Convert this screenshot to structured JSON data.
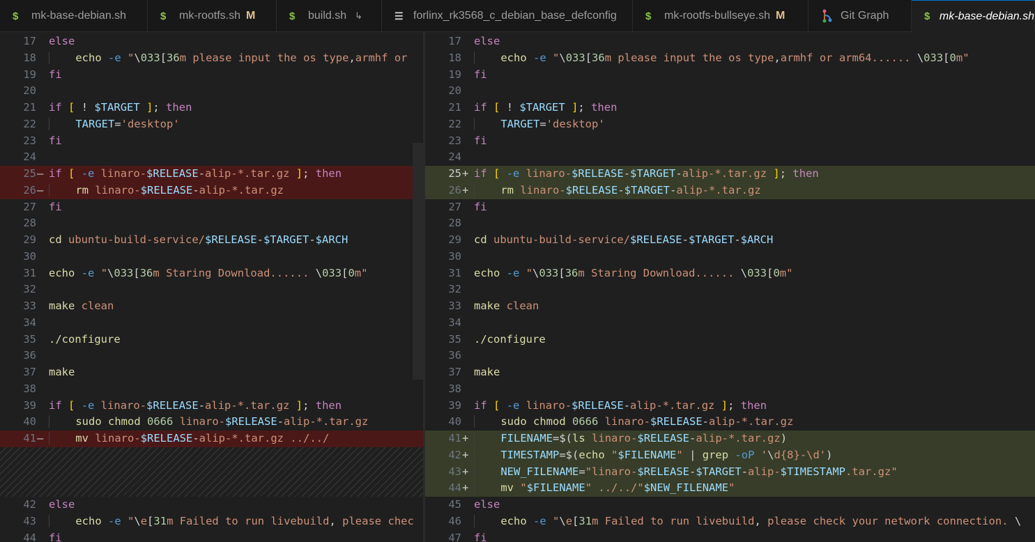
{
  "tabs": [
    {
      "label": "mk-base-debian.sh",
      "icon": "dollar-icon",
      "badge": "",
      "link": false,
      "active": false
    },
    {
      "label": "mk-rootfs.sh",
      "icon": "dollar-icon",
      "badge": "M",
      "link": false,
      "active": false
    },
    {
      "label": "build.sh",
      "icon": "dollar-icon",
      "badge": "",
      "link": true,
      "active": false
    },
    {
      "label": "forlinx_rk3568_c_debian_base_defconfig",
      "icon": "lines-icon",
      "badge": "",
      "link": false,
      "active": false
    },
    {
      "label": "mk-rootfs-bullseye.sh",
      "icon": "dollar-icon",
      "badge": "M",
      "link": false,
      "active": false
    },
    {
      "label": "Git Graph",
      "icon": "git-graph-icon",
      "badge": "",
      "link": false,
      "active": false
    },
    {
      "label": "mk-base-debian.sh",
      "icon": "dollar-icon",
      "badge": "",
      "link": false,
      "active": true
    }
  ],
  "left": [
    {
      "n": "17",
      "code": "else"
    },
    {
      "n": "18",
      "code": "    echo -e \"\\033[36m please input the os type,armhf or"
    },
    {
      "n": "19",
      "code": "fi"
    },
    {
      "n": "20",
      "code": ""
    },
    {
      "n": "21",
      "code": "if [ ! $TARGET ]; then"
    },
    {
      "n": "22",
      "code": "    TARGET='desktop'"
    },
    {
      "n": "23",
      "code": "fi"
    },
    {
      "n": "24",
      "code": ""
    },
    {
      "n": "25",
      "code": "if [ -e linaro-$RELEASE-alip-*.tar.gz ]; then",
      "mark": "—",
      "kind": "del"
    },
    {
      "n": "26",
      "code": "    rm linaro-$RELEASE-alip-*.tar.gz",
      "mark": "—",
      "kind": "del"
    },
    {
      "n": "27",
      "code": "fi"
    },
    {
      "n": "28",
      "code": ""
    },
    {
      "n": "29",
      "code": "cd ubuntu-build-service/$RELEASE-$TARGET-$ARCH"
    },
    {
      "n": "30",
      "code": ""
    },
    {
      "n": "31",
      "code": "echo -e \"\\033[36m Staring Download...... \\033[0m\""
    },
    {
      "n": "32",
      "code": ""
    },
    {
      "n": "33",
      "code": "make clean"
    },
    {
      "n": "34",
      "code": ""
    },
    {
      "n": "35",
      "code": "./configure"
    },
    {
      "n": "36",
      "code": ""
    },
    {
      "n": "37",
      "code": "make"
    },
    {
      "n": "38",
      "code": ""
    },
    {
      "n": "39",
      "code": "if [ -e linaro-$RELEASE-alip-*.tar.gz ]; then"
    },
    {
      "n": "40",
      "code": "    sudo chmod 0666 linaro-$RELEASE-alip-*.tar.gz"
    },
    {
      "n": "41",
      "code": "    mv linaro-$RELEASE-alip-*.tar.gz ../../",
      "mark": "—",
      "kind": "del"
    },
    {
      "filler": true
    },
    {
      "n": "42",
      "code": "else"
    },
    {
      "n": "43",
      "code": "    echo -e \"\\e[31m Failed to run livebuild, please chec"
    },
    {
      "n": "44",
      "code": "fi"
    }
  ],
  "right": [
    {
      "n": "17",
      "code": "else"
    },
    {
      "n": "18",
      "code": "    echo -e \"\\033[36m please input the os type,armhf or arm64...... \\033[0m\""
    },
    {
      "n": "19",
      "code": "fi"
    },
    {
      "n": "20",
      "code": ""
    },
    {
      "n": "21",
      "code": "if [ ! $TARGET ]; then"
    },
    {
      "n": "22",
      "code": "    TARGET='desktop'"
    },
    {
      "n": "23",
      "code": "fi"
    },
    {
      "n": "24",
      "code": ""
    },
    {
      "n": "25",
      "code": "if [ -e linaro-$RELEASE-$TARGET-alip-*.tar.gz ]; then",
      "mark": "+",
      "kind": "ins",
      "cur": true
    },
    {
      "n": "26",
      "code": "    rm linaro-$RELEASE-$TARGET-alip-*.tar.gz",
      "mark": "+",
      "kind": "ins"
    },
    {
      "n": "27",
      "code": "fi"
    },
    {
      "n": "28",
      "code": ""
    },
    {
      "n": "29",
      "code": "cd ubuntu-build-service/$RELEASE-$TARGET-$ARCH"
    },
    {
      "n": "30",
      "code": ""
    },
    {
      "n": "31",
      "code": "echo -e \"\\033[36m Staring Download...... \\033[0m\""
    },
    {
      "n": "32",
      "code": ""
    },
    {
      "n": "33",
      "code": "make clean"
    },
    {
      "n": "34",
      "code": ""
    },
    {
      "n": "35",
      "code": "./configure"
    },
    {
      "n": "36",
      "code": ""
    },
    {
      "n": "37",
      "code": "make"
    },
    {
      "n": "38",
      "code": ""
    },
    {
      "n": "39",
      "code": "if [ -e linaro-$RELEASE-alip-*.tar.gz ]; then"
    },
    {
      "n": "40",
      "code": "    sudo chmod 0666 linaro-$RELEASE-alip-*.tar.gz"
    },
    {
      "n": "41",
      "code": "    FILENAME=$(ls linaro-$RELEASE-alip-*.tar.gz)",
      "mark": "+",
      "kind": "ins"
    },
    {
      "n": "42",
      "code": "    TIMESTAMP=$(echo \"$FILENAME\" | grep -oP '\\d{8}-\\d')",
      "mark": "+",
      "kind": "ins"
    },
    {
      "n": "43",
      "code": "    NEW_FILENAME=\"linaro-$RELEASE-$TARGET-alip-$TIMESTAMP.tar.gz\"",
      "mark": "+",
      "kind": "ins"
    },
    {
      "n": "44",
      "code": "    mv \"$FILENAME\" ../../\"$NEW_FILENAME\"",
      "mark": "+",
      "kind": "ins"
    },
    {
      "n": "45",
      "code": "else"
    },
    {
      "n": "46",
      "code": "    echo -e \"\\e[31m Failed to run livebuild, please check your network connection. \\"
    },
    {
      "n": "47",
      "code": "fi"
    }
  ],
  "colors": {
    "deleted": "#4b1818",
    "inserted": "#373d29",
    "keyword": "#c586c0",
    "string": "#ce9178",
    "variable": "#9cdcfe"
  }
}
